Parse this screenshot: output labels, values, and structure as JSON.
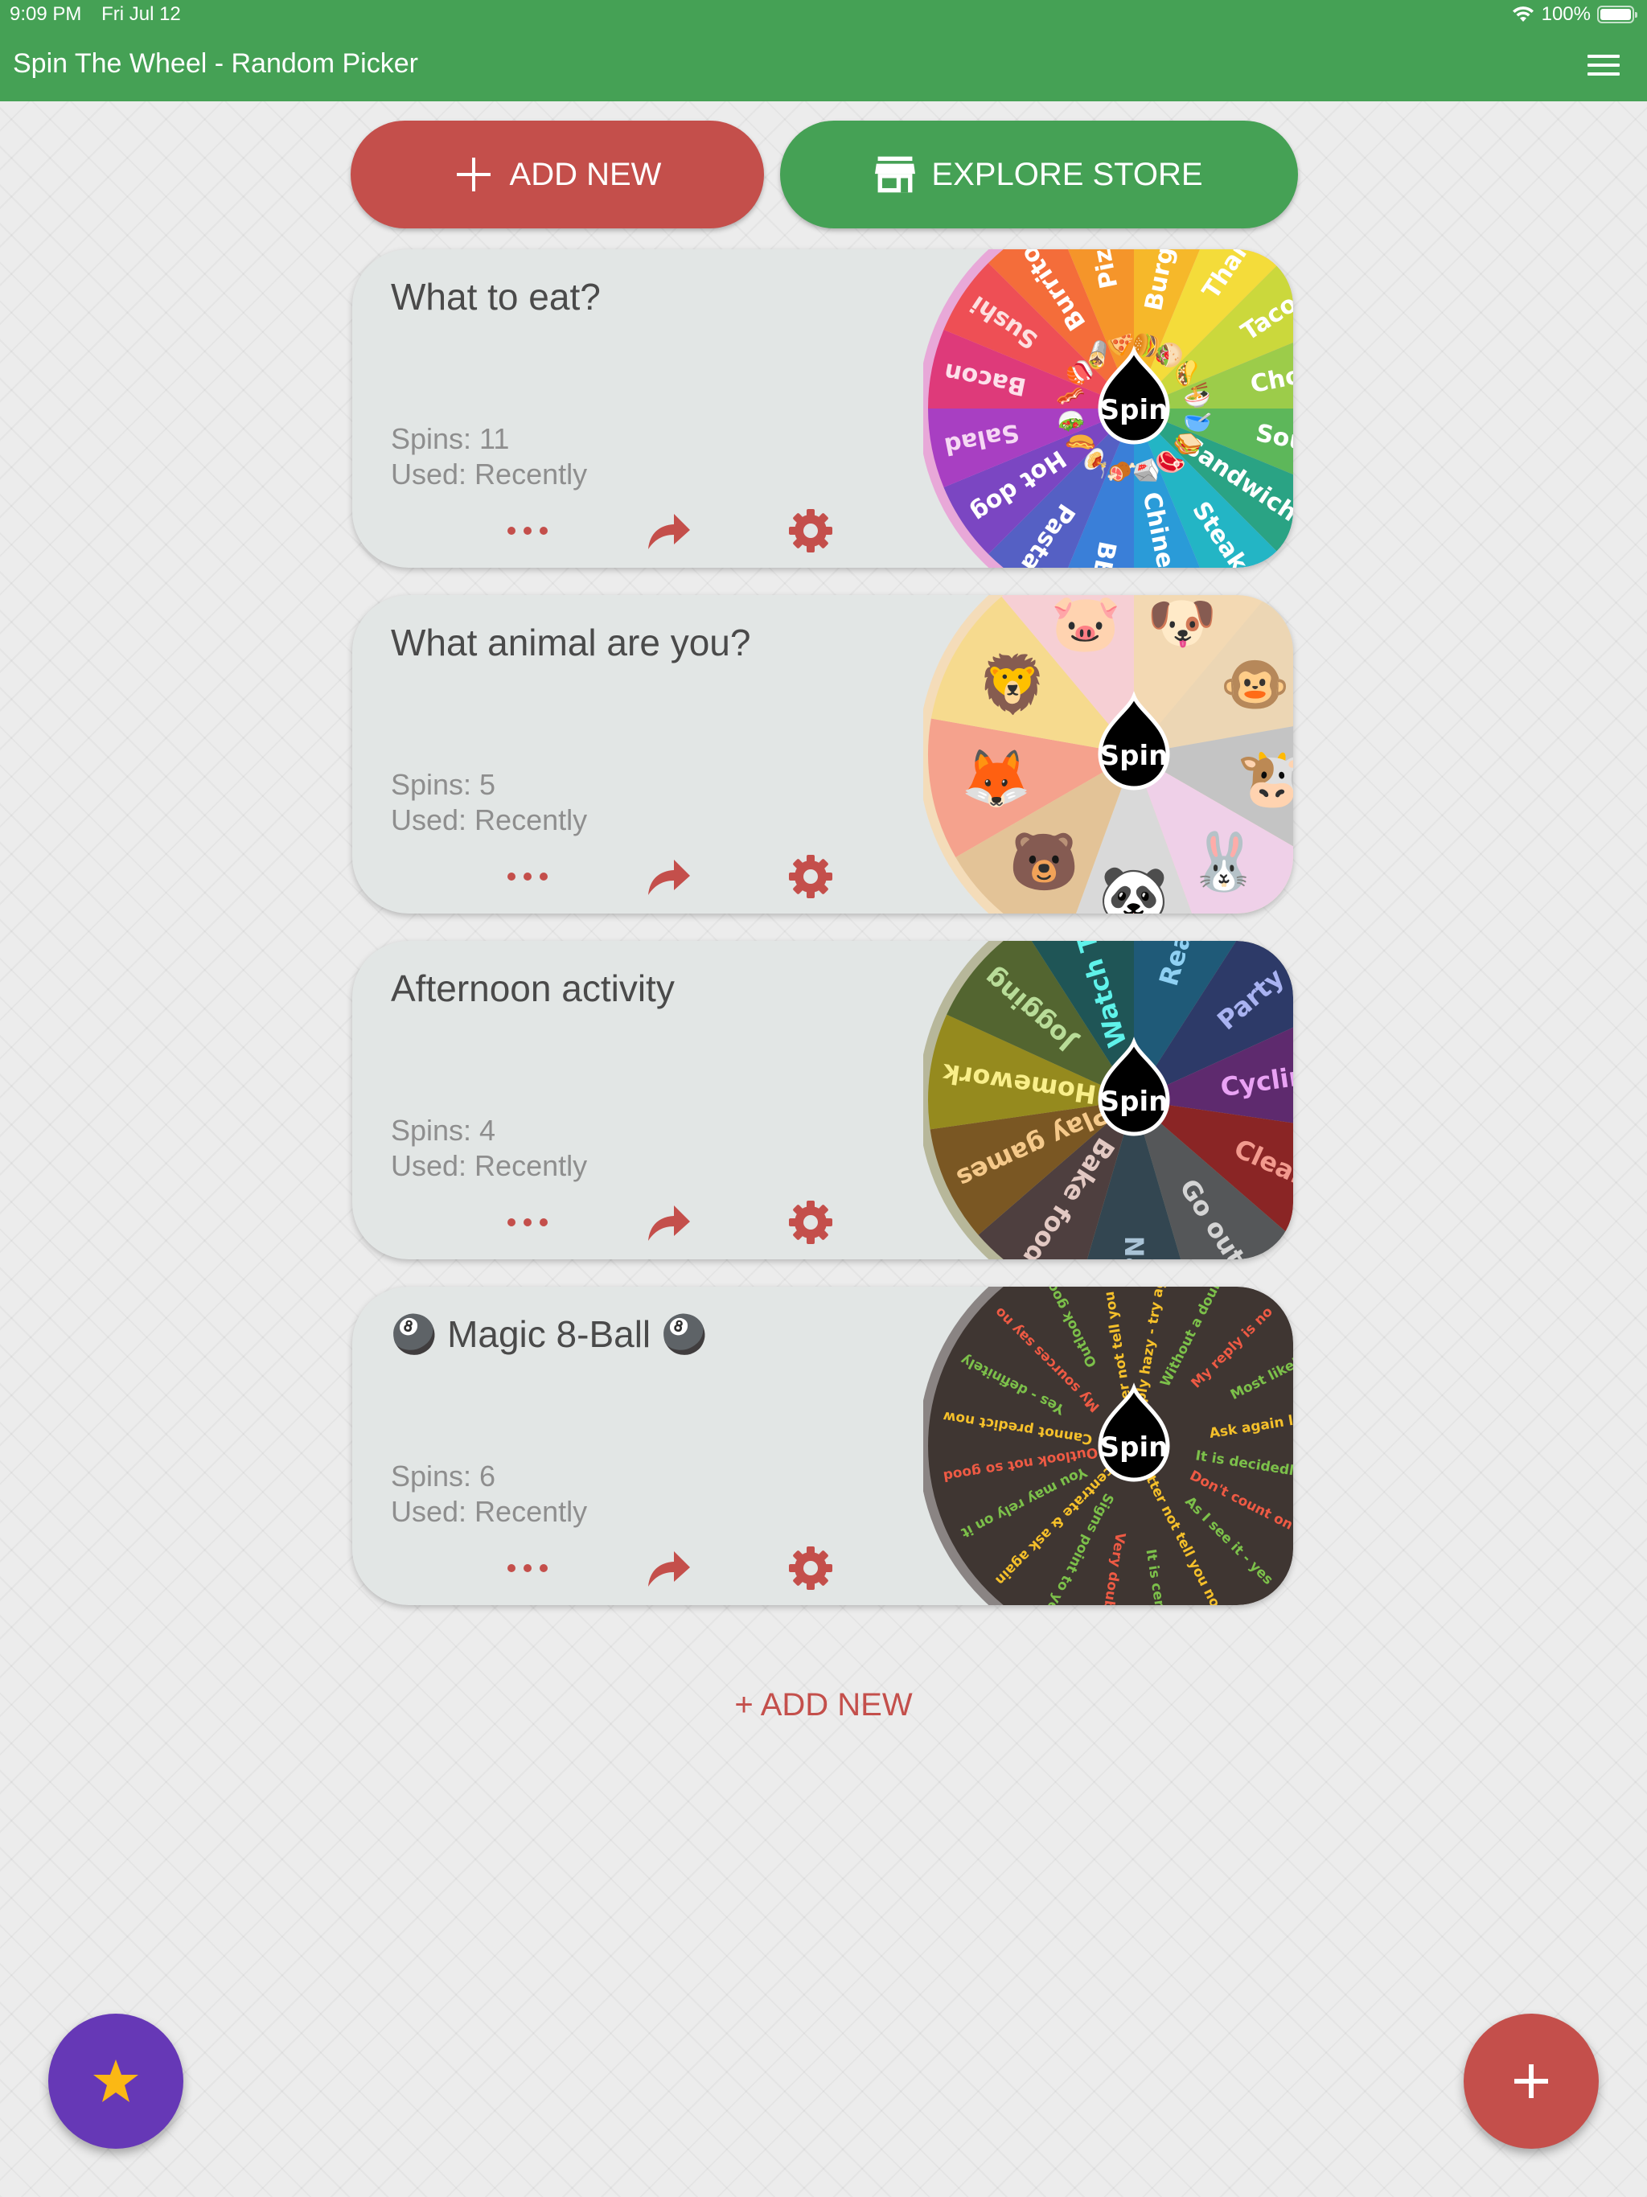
{
  "status_bar": {
    "time": "9:09 PM",
    "date": "Fri Jul 12",
    "battery": "100%",
    "wifi_icon": "wifi-icon",
    "battery_icon": "battery-icon"
  },
  "app_bar": {
    "title": "Spin The Wheel - Random Picker",
    "menu_icon": "hamburger-menu-icon"
  },
  "top_actions": {
    "add_new": {
      "label": "ADD NEW",
      "icon": "plus-icon",
      "color": "#c44f4b"
    },
    "explore_store": {
      "label": "EXPLORE STORE",
      "icon": "store-icon",
      "color": "#45a155"
    }
  },
  "wheels": [
    {
      "title": "What to eat?",
      "spins": "Spins: 11",
      "used": "Used: Recently",
      "spin_label": "Spin",
      "style": "rainbow",
      "segments": [
        {
          "label": "Burger",
          "emoji": "🍔",
          "color": "#f6b82a",
          "text": "#ffffff"
        },
        {
          "label": "Thai",
          "emoji": "🥙",
          "color": "#f4dc3a",
          "text": "#ffffff"
        },
        {
          "label": "Taco",
          "emoji": "🌮",
          "color": "#cbd83c",
          "text": "#ffffff"
        },
        {
          "label": "Chow",
          "emoji": "🍜",
          "color": "#9ccc4a",
          "text": "#ffffff"
        },
        {
          "label": "Soup",
          "emoji": "🥣",
          "color": "#5db75a",
          "text": "#ffffff"
        },
        {
          "label": "Sandwich",
          "emoji": "🥪",
          "color": "#2aa384",
          "text": "#ffffff"
        },
        {
          "label": "Steak",
          "emoji": "🥩",
          "color": "#23b5c5",
          "text": "#ffffff"
        },
        {
          "label": "Chinese",
          "emoji": "🥡",
          "color": "#2a9bd8",
          "text": "#ffffff"
        },
        {
          "label": "BBQ",
          "emoji": "🍖",
          "color": "#3a7fd8",
          "text": "#ffffff"
        },
        {
          "label": "Pasta",
          "emoji": "🍝",
          "color": "#5560c4",
          "text": "#ffffff"
        },
        {
          "label": "Hot dog",
          "emoji": "🌭",
          "color": "#7b46c2",
          "text": "#ffffff"
        },
        {
          "label": "Salad",
          "emoji": "🥗",
          "color": "#a83fc2",
          "text": "#f6d8f4"
        },
        {
          "label": "Bacon",
          "emoji": "🥓",
          "color": "#de3a7a",
          "text": "#fde0ea"
        },
        {
          "label": "Sushi",
          "emoji": "🍣",
          "color": "#ee4f55",
          "text": "#fde0e0"
        },
        {
          "label": "Burrito",
          "emoji": "🌯",
          "color": "#f46d3a",
          "text": "#ffffff"
        },
        {
          "label": "Pizza",
          "emoji": "🍕",
          "color": "#f5952a",
          "text": "#ffffff"
        }
      ]
    },
    {
      "title": "What animal are you?",
      "spins": "Spins: 5",
      "used": "Used: Recently",
      "spin_label": "Spin",
      "style": "emoji",
      "segments": [
        {
          "label": "Dog",
          "emoji": "🐶",
          "color": "#f3d9b3"
        },
        {
          "label": "Monkey",
          "emoji": "🐵",
          "color": "#ecd6b4"
        },
        {
          "label": "Cow",
          "emoji": "🐮",
          "color": "#c4c4c4"
        },
        {
          "label": "Rabbit",
          "emoji": "🐰",
          "color": "#efd0e8"
        },
        {
          "label": "Panda",
          "emoji": "🐼",
          "color": "#d9d9d9"
        },
        {
          "label": "Bear",
          "emoji": "🐻",
          "color": "#e3c397"
        },
        {
          "label": "Fox",
          "emoji": "🦊",
          "color": "#f5a28d"
        },
        {
          "label": "Lion",
          "emoji": "🦁",
          "color": "#f6da8e"
        },
        {
          "label": "Pig",
          "emoji": "🐷",
          "color": "#f6cfd4"
        }
      ]
    },
    {
      "title": "Afternoon activity",
      "spins": "Spins: 4",
      "used": "Used: Recently",
      "spin_label": "Spin",
      "style": "text",
      "segments": [
        {
          "label": "Read",
          "color": "#1f5a78",
          "text": "#8fd0f2"
        },
        {
          "label": "Party",
          "color": "#2d3a68",
          "text": "#a9b3f2"
        },
        {
          "label": "Cycling",
          "color": "#5e2a6e",
          "text": "#e9a2f4"
        },
        {
          "label": "Clean",
          "color": "#8a2525",
          "text": "#f29a8e"
        },
        {
          "label": "Go out",
          "color": "#555759",
          "text": "#d4d4d4"
        },
        {
          "label": "Nap",
          "color": "#334651",
          "text": "#a9c3d6"
        },
        {
          "label": "Bake food",
          "color": "#4e3f3f",
          "text": "#e2c8c2"
        },
        {
          "label": "Play games",
          "color": "#7a5723",
          "text": "#f5c98a"
        },
        {
          "label": "Homework",
          "color": "#958a1e",
          "text": "#f9ef8a"
        },
        {
          "label": "Jogging",
          "color": "#536530",
          "text": "#b8dc98"
        },
        {
          "label": "Watch TV",
          "color": "#1f5556",
          "text": "#5ff2ea"
        }
      ]
    },
    {
      "title": "Magic 8-Ball",
      "title_emoji": "🎱",
      "spins": "Spins: 6",
      "used": "Used: Recently",
      "spin_label": "Spin",
      "style": "dark",
      "segments": [
        {
          "label": "Reply hazy - try again",
          "text": "#f5c02a"
        },
        {
          "label": "Without a doubt",
          "text": "#7cc04a"
        },
        {
          "label": "My reply is no",
          "text": "#ee5a44"
        },
        {
          "label": "Most likely",
          "text": "#7cc04a"
        },
        {
          "label": "Ask again later",
          "text": "#f5c02a"
        },
        {
          "label": "It is decidedly so",
          "text": "#7cc04a"
        },
        {
          "label": "Don't count on it",
          "text": "#ee5a44"
        },
        {
          "label": "As I see it - yes",
          "text": "#7cc04a"
        },
        {
          "label": "Better not tell you now",
          "text": "#f5c02a"
        },
        {
          "label": "It is certain",
          "text": "#7cc04a"
        },
        {
          "label": "Very doubtful",
          "text": "#ee5a44"
        },
        {
          "label": "Signs point to yes",
          "text": "#7cc04a"
        },
        {
          "label": "Concentrate & ask again",
          "text": "#f5c02a"
        },
        {
          "label": "You may rely on it",
          "text": "#7cc04a"
        },
        {
          "label": "Outlook not so good",
          "text": "#ee5a44"
        },
        {
          "label": "Cannot predict now",
          "text": "#f5c02a"
        },
        {
          "label": "Yes - definitely",
          "text": "#7cc04a"
        },
        {
          "label": "My sources say no",
          "text": "#ee5a44"
        },
        {
          "label": "Outlook good",
          "text": "#7cc04a"
        },
        {
          "label": "Better not tell you now",
          "text": "#f5c02a"
        }
      ]
    }
  ],
  "card_actions": {
    "more_icon": "more-dots-icon",
    "share_icon": "share-arrow-icon",
    "settings_icon": "gear-icon",
    "accent": "#c44f4b"
  },
  "add_new_link": {
    "label": "+ ADD NEW"
  },
  "fabs": {
    "favorites_icon": "star-icon",
    "add_icon": "plus-icon",
    "favorites_color": "#6638b6",
    "star_color": "#fbb814",
    "add_color": "#c44f4b"
  }
}
